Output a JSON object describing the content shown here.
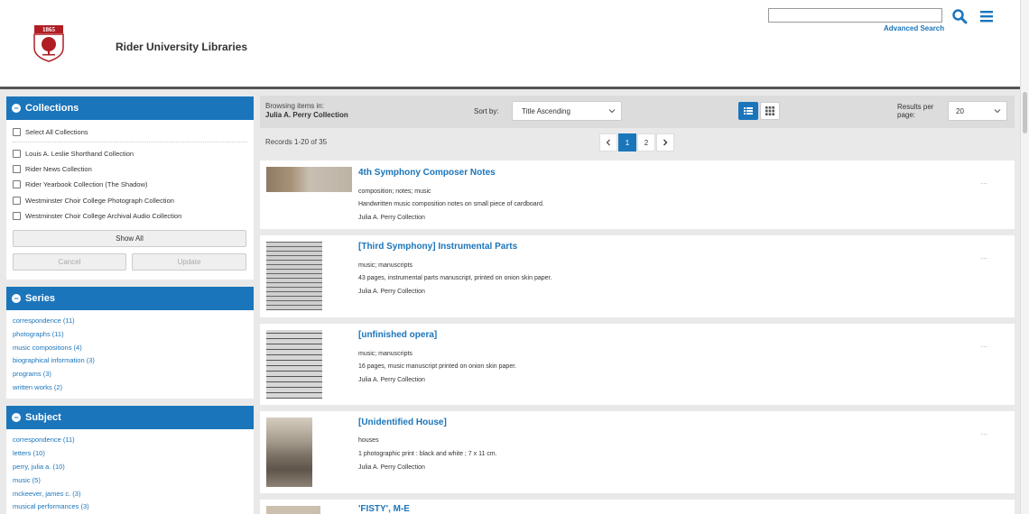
{
  "header": {
    "site_name": "Rider University Libraries",
    "logo_year": "1865",
    "search": {
      "value": "",
      "placeholder": ""
    },
    "advanced_search": "Advanced Search"
  },
  "sidebar": {
    "collections": {
      "title": "Collections",
      "select_all": "Select All Collections",
      "items": [
        {
          "label": "Louis A. Leslie Shorthand Collection"
        },
        {
          "label": "Rider News Collection"
        },
        {
          "label": "Rider Yearbook Collection (The Shadow)"
        },
        {
          "label": "Westminster Choir College Photograph Collection"
        },
        {
          "label": "Westminster Choir College Archival Audio Collection"
        }
      ],
      "show_all": "Show All",
      "cancel": "Cancel",
      "update": "Update"
    },
    "series": {
      "title": "Series",
      "items": [
        {
          "label": "correspondence (11)"
        },
        {
          "label": "photographs (11)"
        },
        {
          "label": "music compositions (4)"
        },
        {
          "label": "biographical information (3)"
        },
        {
          "label": "programs (3)"
        },
        {
          "label": "written works (2)"
        }
      ]
    },
    "subject": {
      "title": "Subject",
      "items": [
        {
          "label": "correspondence (11)"
        },
        {
          "label": "letters (10)"
        },
        {
          "label": "perry, julia a. (10)"
        },
        {
          "label": "music (5)"
        },
        {
          "label": "mckeever, james c. (3)"
        },
        {
          "label": "musical performances (3)"
        }
      ]
    }
  },
  "toolbar": {
    "browsing_label": "Browsing items in:",
    "browsing_name": "Julia A. Perry Collection",
    "sort_label": "Sort by:",
    "sort_value": "Title Ascending",
    "rpp_label_1": "Results per",
    "rpp_label_2": "page:",
    "rpp_value": "20"
  },
  "results": {
    "count_text": "Records 1-20 of 35",
    "pages": [
      "1",
      "2"
    ],
    "current_page": 1,
    "items": [
      {
        "title": "4th Symphony Composer Notes",
        "type": "composition; notes; music",
        "desc": "Handwritten music composition notes on small piece of cardboard.",
        "collection": "Julia A. Perry Collection",
        "dots": "..."
      },
      {
        "title": "[Third Symphony] Instrumental Parts",
        "type": "music; manuscripts",
        "desc": "43 pages, instrumental parts manuscript, printed on onion skin paper.",
        "collection": "Julia A. Perry Collection",
        "dots": "..."
      },
      {
        "title": "[unfinished opera]",
        "type": "music; manuscripts",
        "desc": "16 pages, music manuscript printed on onion skin paper.",
        "collection": "Julia A. Perry Collection",
        "dots": "..."
      },
      {
        "title": "[Unidentified House]",
        "type": "houses",
        "desc": "1 photographic print : black and white ; 7 x 11 cm.",
        "collection": "Julia A. Perry Collection",
        "dots": "..."
      },
      {
        "title": "'FISTY', M-E",
        "type": "",
        "desc": "",
        "collection": "",
        "dots": ""
      }
    ]
  },
  "colors": {
    "accent": "#1b75bb",
    "panel_bg": "#dcdcdc",
    "header_rule": "#555555"
  }
}
